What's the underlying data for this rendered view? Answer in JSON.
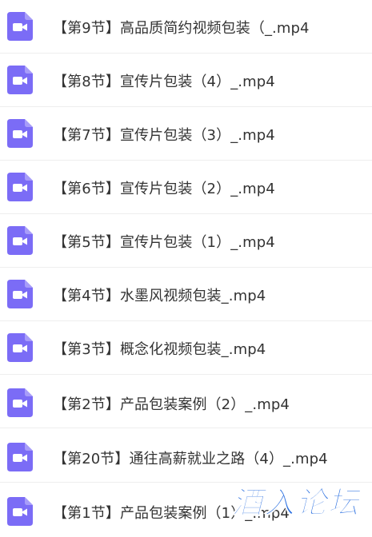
{
  "files": [
    {
      "name": "【第9节】高品质简约视频包装（_.mp4",
      "type_icon": "video-file-icon"
    },
    {
      "name": "【第8节】宣传片包装（4）_.mp4",
      "type_icon": "video-file-icon"
    },
    {
      "name": "【第7节】宣传片包装（3）_.mp4",
      "type_icon": "video-file-icon"
    },
    {
      "name": "【第6节】宣传片包装（2）_.mp4",
      "type_icon": "video-file-icon"
    },
    {
      "name": "【第5节】宣传片包装（1）_.mp4",
      "type_icon": "video-file-icon"
    },
    {
      "name": "【第4节】水墨风视频包装_.mp4",
      "type_icon": "video-file-icon"
    },
    {
      "name": "【第3节】概念化视频包装_.mp4",
      "type_icon": "video-file-icon"
    },
    {
      "name": "【第2节】产品包装案例（2）_.mp4",
      "type_icon": "video-file-icon"
    },
    {
      "name": "【第20节】通往高薪就业之路（4）_.mp4",
      "type_icon": "video-file-icon"
    },
    {
      "name": "【第1节】产品包装案例（1）_.mp4",
      "type_icon": "video-file-icon"
    }
  ],
  "watermark": {
    "text": "酒入论坛"
  },
  "colors": {
    "icon": "#7b6cf6",
    "icon_fold": "#a79cf9",
    "text": "#333333",
    "divider": "#eeeeee",
    "watermark": "#2a6fe0"
  }
}
